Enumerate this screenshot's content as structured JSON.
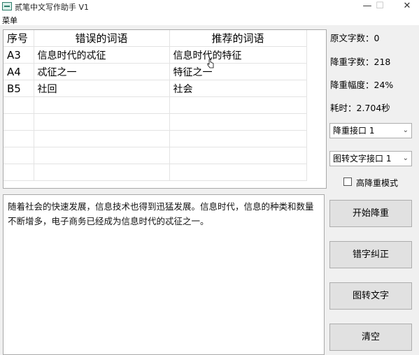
{
  "window": {
    "title": "贰笔中文写作助手 V1",
    "minimize": "—",
    "maximize": "☐",
    "close": "✕"
  },
  "menu": {
    "label": "菜单"
  },
  "table": {
    "headers": [
      "序号",
      "错误的词语",
      "推荐的词语"
    ],
    "rows": [
      [
        "A3",
        "信息时代的忒征",
        "信息时代的特征"
      ],
      [
        "A4",
        "忒征之一",
        "特征之一"
      ],
      [
        "B5",
        "社回",
        "社会"
      ]
    ]
  },
  "text": {
    "content": "随着社会的快速发展，信息技术也得到迅猛发展。信息时代，信息的种类和数量不断增多，电子商务已经成为信息时代的忒征之一。"
  },
  "stats": {
    "original_count": "原文字数：0",
    "reduced_count": "降重字数：218",
    "reduction_rate": "降重幅度：24%",
    "time": "耗时：2.704秒"
  },
  "selects": {
    "api": "降重接口 1",
    "ocr": "图转文字接口 1"
  },
  "checkbox": {
    "label": "高降重模式",
    "checked": false
  },
  "buttons": {
    "start": "开始降重",
    "correct": "错字纠正",
    "ocr": "图转文字",
    "clear": "清空"
  }
}
